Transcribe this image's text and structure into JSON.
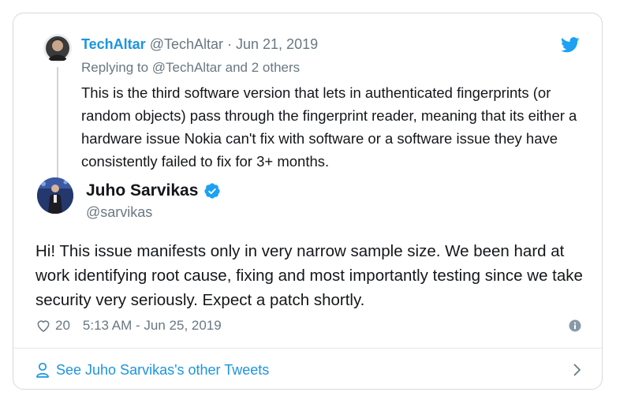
{
  "parent_tweet": {
    "author_name": "TechAltar",
    "author_handle": "@TechAltar",
    "separator": " · ",
    "date": "Jun 21, 2019",
    "reply_prefix": "Replying to ",
    "reply_to": "@TechAltar and 2 others",
    "text": "This is the third software version that lets in authenticated fingerprints (or random objects) pass through the fingerprint reader, meaning that its either a hardware issue Nokia can't fix with software or a software issue they have consistently failed to fix for 3+ months."
  },
  "main_tweet": {
    "author_name": "Juho Sarvikas",
    "author_handle": "@sarvikas",
    "verified": true,
    "text": "Hi! This issue manifests only in very narrow sample size. We been hard at work identifying root cause, fixing and most importantly testing since we take security very seriously. Expect a patch shortly.",
    "like_count": "20",
    "timestamp": "5:13 AM - Jun 25, 2019"
  },
  "footer": {
    "label": "See Juho Sarvikas's other Tweets"
  },
  "icons": {
    "brand": "twitter-bird-icon",
    "verified": "verified-badge-icon",
    "like": "heart-icon",
    "info": "info-icon",
    "profile": "person-icon",
    "more": "chevron-right-icon"
  },
  "colors": {
    "brand_blue": "#1b95e0",
    "verified_blue": "#1da1f2",
    "text": "#14171a",
    "muted": "#697882",
    "border": "#d4dadf"
  }
}
